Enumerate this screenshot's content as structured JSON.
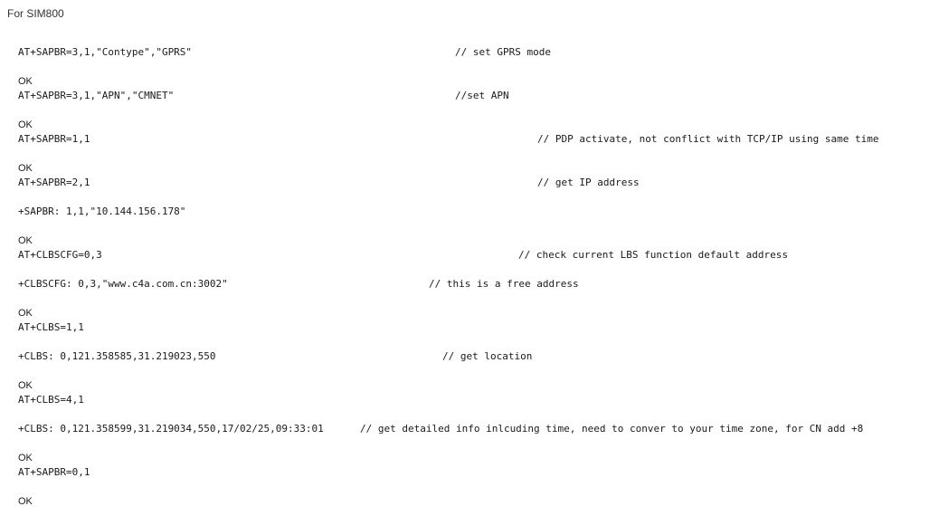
{
  "title": "For SIM800",
  "lines": [
    {
      "type": "cmd",
      "text": "AT+SAPBR=3,1,\"Contype\",\"GPRS\"",
      "comment": "// set GPRS mode"
    },
    {
      "type": "ok",
      "text": "OK"
    },
    {
      "type": "cmd",
      "text": "AT+SAPBR=3,1,\"APN\",\"CMNET\"",
      "comment": "//set APN"
    },
    {
      "type": "ok",
      "text": "OK"
    },
    {
      "type": "cmd",
      "text": "AT+SAPBR=1,1",
      "comment": "// PDP activate, not conflict with TCP/IP using same time"
    },
    {
      "type": "ok",
      "text": "OK"
    },
    {
      "type": "cmd",
      "text": "AT+SAPBR=2,1",
      "comment": "// get IP address"
    },
    {
      "type": "resp",
      "text": "+SAPBR: 1,1,\"10.144.156.178\""
    },
    {
      "type": "ok",
      "text": "OK"
    },
    {
      "type": "cmd",
      "text": "AT+CLBSCFG=0,3",
      "comment": "// check current LBS function default address"
    },
    {
      "type": "resp",
      "text": "+CLBSCFG: 0,3,\"www.c4a.com.cn:3002\"",
      "comment": "// this is a free address"
    },
    {
      "type": "ok",
      "text": "OK"
    },
    {
      "type": "cmd",
      "text": "AT+CLBS=1,1"
    },
    {
      "type": "resp",
      "text": "+CLBS: 0,121.358585,31.219023,550",
      "comment": "// get location"
    },
    {
      "type": "ok",
      "text": "OK"
    },
    {
      "type": "cmd",
      "text": "AT+CLBS=4,1"
    },
    {
      "type": "resp",
      "text": "+CLBS: 0,121.358599,31.219034,550,17/02/25,09:33:01",
      "comment": "// get detailed info inlcuding time, need to conver to your time zone, for CN add +8"
    },
    {
      "type": "ok",
      "text": "OK"
    },
    {
      "type": "cmd",
      "text": "AT+SAPBR=0,1"
    },
    {
      "type": "ok",
      "text": "OK"
    }
  ]
}
